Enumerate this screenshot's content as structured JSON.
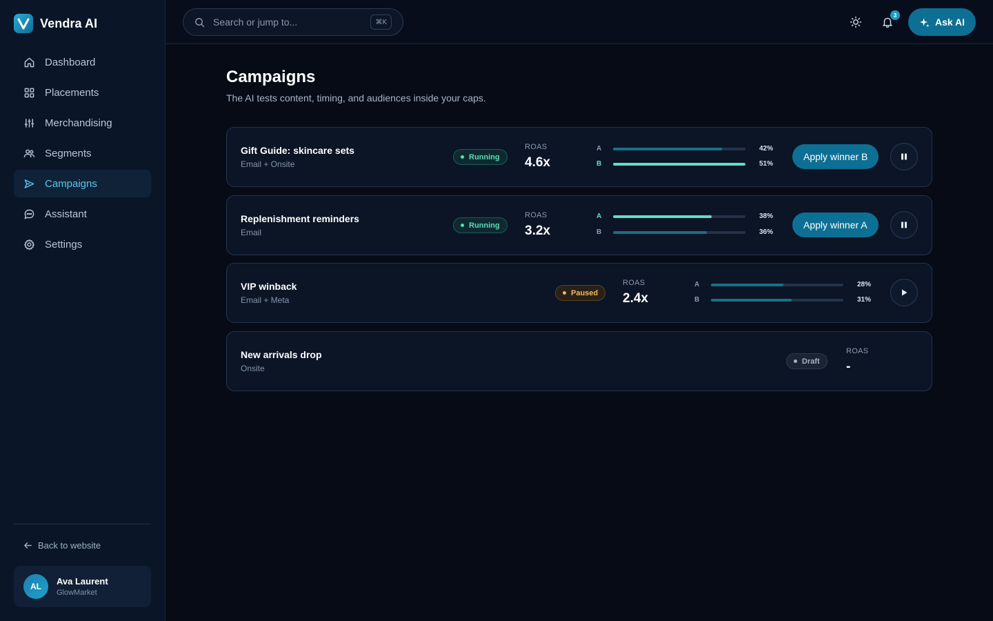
{
  "brand": {
    "name": "Vendra AI",
    "logo_letter": "V"
  },
  "sidebar": {
    "items": [
      {
        "label": "Dashboard",
        "icon": "home-icon",
        "active": false
      },
      {
        "label": "Placements",
        "icon": "grid-icon",
        "active": false
      },
      {
        "label": "Merchandising",
        "icon": "sliders-icon",
        "active": false
      },
      {
        "label": "Segments",
        "icon": "users-icon",
        "active": false
      },
      {
        "label": "Campaigns",
        "icon": "send-icon",
        "active": true
      },
      {
        "label": "Assistant",
        "icon": "chat-icon",
        "active": false
      },
      {
        "label": "Settings",
        "icon": "gear-icon",
        "active": false
      }
    ],
    "back_link": "Back to website",
    "user": {
      "initials": "AL",
      "name": "Ava Laurent",
      "org": "GlowMarket"
    }
  },
  "topbar": {
    "search_placeholder": "Search or jump to...",
    "search_shortcut": "⌘K",
    "notification_count": "3",
    "ask_ai_label": "Ask AI"
  },
  "page": {
    "title": "Campaigns",
    "subtitle": "The AI tests content, timing, and audiences inside your caps."
  },
  "campaigns": [
    {
      "name": "Gift Guide: skincare sets",
      "channel": "Email + Onsite",
      "status": "Running",
      "roas_label": "ROAS",
      "roas": "4.6x",
      "variants": [
        {
          "label": "A",
          "pct": "42%",
          "value": 0.42
        },
        {
          "label": "B",
          "pct": "51%",
          "value": 0.51
        }
      ],
      "action_label": "Apply winner B",
      "toggle": "pause"
    },
    {
      "name": "Replenishment reminders",
      "channel": "Email",
      "status": "Running",
      "roas_label": "ROAS",
      "roas": "3.2x",
      "variants": [
        {
          "label": "A",
          "pct": "38%",
          "value": 0.38
        },
        {
          "label": "B",
          "pct": "36%",
          "value": 0.36
        }
      ],
      "action_label": "Apply winner A",
      "toggle": "pause"
    },
    {
      "name": "VIP winback",
      "channel": "Email + Meta",
      "status": "Paused",
      "roas_label": "ROAS",
      "roas": "2.4x",
      "variants": [
        {
          "label": "A",
          "pct": "28%",
          "value": 0.28
        },
        {
          "label": "B",
          "pct": "31%",
          "value": 0.31
        }
      ],
      "toggle": "play"
    },
    {
      "name": "New arrivals drop",
      "channel": "Onsite",
      "status": "Draft",
      "roas_label": "ROAS",
      "roas": "-"
    }
  ],
  "colors": {
    "accent": "#0e6f94",
    "active_nav": "#5cc8ee",
    "variant_win": "#5fe0c8",
    "variant_lose": "#1a6f88",
    "running": "#5fd9b8",
    "paused": "#f1b86a",
    "draft": "#a6b3c4"
  }
}
